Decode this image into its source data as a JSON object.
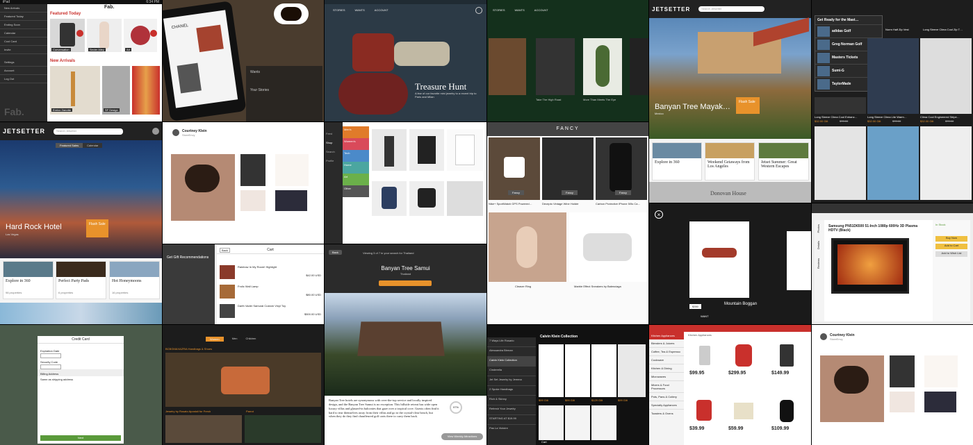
{
  "fab": {
    "logo": "Fab.",
    "featured_title": "Featured Today",
    "new_title": "New Arrivals",
    "featured": [
      "Conversation",
      "Sexier Alley",
      "Art"
    ],
    "arrivals": [
      "Enrico Zanotte",
      "SF Design",
      "SF Design"
    ],
    "sidebar": [
      "New Arrivals",
      "Featured Today",
      "Ending Soon",
      "Calendar",
      "Cool Card",
      "Invite",
      "Settings",
      "Account",
      "Log Out"
    ],
    "watermark": "Fab."
  },
  "chanel": {
    "heading_a": "Wants",
    "heading_b": "Your Stories",
    "brand": "CHANEL"
  },
  "treasure": {
    "nav": [
      "STORIES",
      "WANTS",
      "ACCOUNT"
    ],
    "title": "Treasure Hunt",
    "sub": "A few of our favorite mini jewelry to a recent trip to Paris and Milan"
  },
  "stories": {
    "nav": [
      "STORIES",
      "WANTS",
      "ACCOUNT"
    ],
    "items": [
      "Take The High Road",
      "More Than Meets The Eye",
      "Carbon Fiber"
    ]
  },
  "jetsetter_top": {
    "logo": "JETSETTER",
    "search": "Search Jetsetter",
    "hotel": "Banyan Tree Mayak…",
    "location": "Mexico",
    "flash": "Flash Sale",
    "cards": [
      "Explore in 360",
      "Weekend Getaways from Los Angeles",
      "Jetset Summer: Great Western Escapes"
    ],
    "house": "Donovan House"
  },
  "gilt_golf": {
    "menu_title": "Get Ready for the Mast…",
    "items": [
      "adidas Golf",
      "Greg Norman Golf",
      "Masters Tickets",
      "Sumi-G",
      "TaylorMade"
    ],
    "products": [
      "Norm Half Zip Vest",
      "Long Sleeve Clima Cool Zip T…",
      "Long Sleeve Clima Cool Enhanc…",
      "Long Sleeve Clima Lite Warm…",
      "Clima Cool Engineered Stripe…"
    ],
    "prices": [
      "$32.00 Gilt",
      "$32.00 Gilt",
      "$32.00 Gilt"
    ],
    "was": [
      "$70.00",
      "$70.00",
      "$70.00"
    ]
  },
  "jetsetter_main": {
    "logo": "JETSETTER",
    "search": "Search Jetsetter",
    "tabs": [
      "Featured Sales",
      "Calendar"
    ],
    "hotel": "Hard Rock Hotel",
    "location": "Las Vegas",
    "flash": "Flash Sale",
    "cards": [
      "Explore in 360",
      "Perfect Party Pads",
      "Hot Honeymoons"
    ],
    "props": [
      "98 properties",
      "6 properties",
      "16 properties"
    ]
  },
  "courtney": {
    "name": "Courtney Klein",
    "sub": "StoreEnvy"
  },
  "shop": {
    "tabs": [
      "Men's",
      "Women's",
      "Tech",
      "Home",
      "Art",
      "Other"
    ],
    "side": [
      "Feed",
      "Shop",
      "Search",
      "Profile"
    ]
  },
  "fancy": {
    "header": "FANCY",
    "items": [
      "Nike+ SportWatch GPS Powered…",
      "Decepto Vintage Wine Holder",
      "Carbon Protective iPhone 5/5s Ca…",
      "Cleaver Ring",
      "Marble Effect Sneakers by Balenciaga"
    ],
    "fancy_btn": "Fancy"
  },
  "gift": {
    "title": "Get Gift Recommendations"
  },
  "cart": {
    "title": "Cart",
    "back": "Back",
    "items": [
      "Rainbow In My Room! Highlight",
      "Frolic Wall Lamp",
      "Darth Vader Samurai Custom Vinyl Toy"
    ],
    "prices": [
      "$42.00 USD",
      "$80.00 USD",
      "$500.00 USD"
    ]
  },
  "banyan": {
    "back": "Back",
    "results": "Viewing 3 of 7 in your search for Thailand",
    "title": "Banyan Tree Samui",
    "location": "Thailand",
    "body": "Banyan Tree hotels are synonymous with over-the-top service and locally inspired design, and the Banyan Tree Samui is no exception. This hillside retreat has wide open luxury villas and glassed-in balconies that gaze over a tropical cove. Guests often find it hard to tear themselves away from their villas and go to the crystal-clear beach, but when they do they find chauffeured golf carts there to carry them back.",
    "score": "97%",
    "btn": "View Weekly Attractions"
  },
  "boggan": {
    "title": "Mountain Boggan",
    "price": "$350",
    "want": "WANT"
  },
  "samsung": {
    "title": "Samsung PN51D6500 51-Inch 1080p 600Hz 3D Plasma HDTV (Black)",
    "in_stock": "In Stock",
    "side": [
      "Photos",
      "Details",
      "Reviews",
      "Related"
    ],
    "buttons": [
      "Buy Now",
      "Add to Cart",
      "Add to Wish List"
    ]
  },
  "credit": {
    "title": "Credit Card",
    "labels": [
      "Expiration Date",
      "Security Code",
      "Billing Address",
      "Same as shipping address"
    ],
    "btn": "Next"
  },
  "gilt_bags": {
    "tabs": [
      "Women",
      "Men",
      "Children"
    ],
    "sec1": "BCBGMAXAZRIA Handbags & Shoes",
    "sec2": "Jewelry by Rosato Apostoli for Fresh",
    "sec3": "Parrot"
  },
  "calvin": {
    "title": "Calvin Klein Collection",
    "items": [
      "7 Ways Life Rosario",
      "Alessandra Birman",
      "Calvin Klein Collection",
      "Cinderella",
      "Jet Set Jewelry by Jemma",
      "2 Spoke Handbags",
      "Rich & Skinny",
      "Refresh Your Jewelry",
      "STARTING AT $19.99",
      "Pas La Victoire"
    ],
    "prices": [
      "$99 Gilt",
      "$99 Gilt",
      "$129 Gilt",
      "$99 Gilt"
    ],
    "cart": "Cart"
  },
  "appliances": {
    "header": "Kitchen Appliances",
    "side": [
      "Kitchen Appliances",
      "Blenders & Juicers",
      "Coffee, Tea & Espresso",
      "Cookware",
      "Kitchen & Dining",
      "Microwaves",
      "Mixers & Food Processors",
      "Pots, Pans & Cutlery",
      "Specialty Appliances",
      "Toasters & Ovens"
    ],
    "prices": [
      "$99.95",
      "$299.95",
      "$149.99",
      "$39.99",
      "$59.99",
      "$109.99"
    ]
  },
  "colors": {
    "red": "#c9302c",
    "orange": "#e8922b",
    "green": "#5a9a3a"
  }
}
